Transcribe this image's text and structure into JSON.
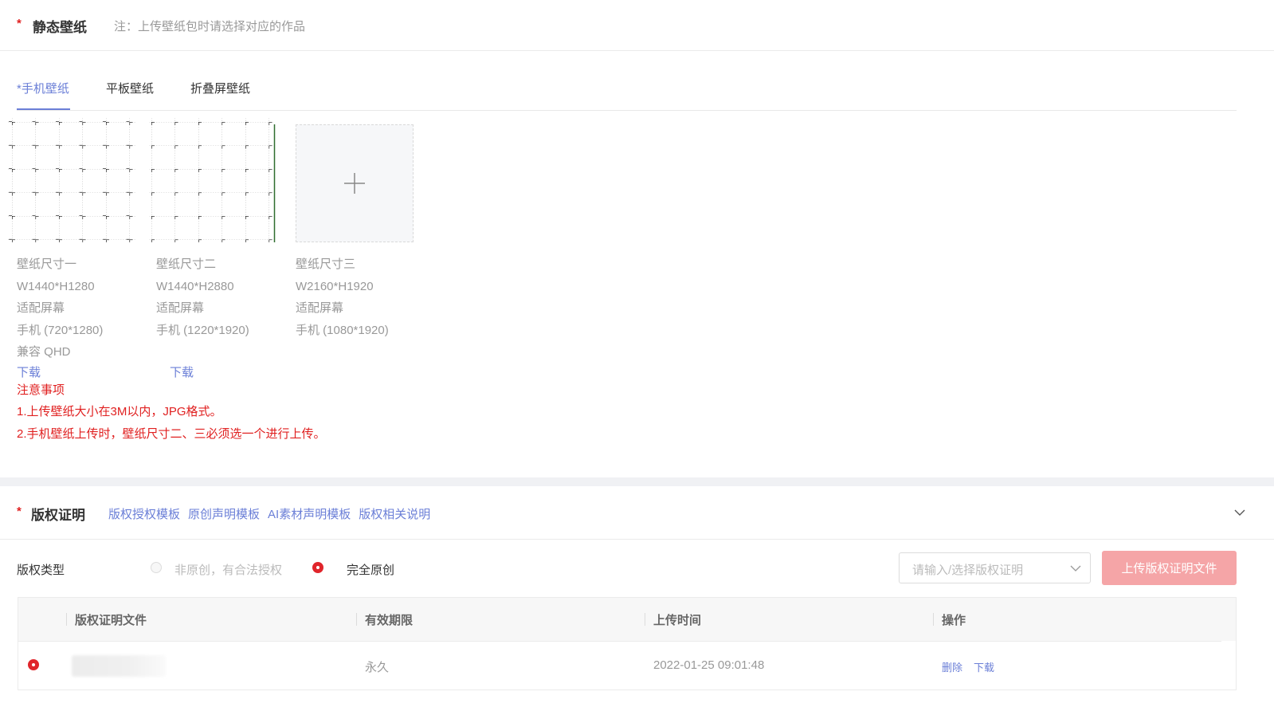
{
  "section1": {
    "star": "*",
    "title": "静态壁纸",
    "hint": "注：上传壁纸包时请选择对应的作品"
  },
  "tabs": [
    {
      "label": "*手机壁纸",
      "active": true
    },
    {
      "label": "平板壁纸",
      "active": false
    },
    {
      "label": "折叠屏壁纸",
      "active": false
    }
  ],
  "slots": [
    {
      "name": "壁纸尺寸一",
      "size": "W1440*H1280",
      "fit_label": "适配屏幕",
      "device": "手机 (720*1280)",
      "compat": "兼容 QHD",
      "download": "下载"
    },
    {
      "name": "壁纸尺寸二",
      "size": "W1440*H2880",
      "fit_label": "适配屏幕",
      "device": "手机 (1220*1920)",
      "download": "下载"
    },
    {
      "name": "壁纸尺寸三",
      "size": "W2160*H1920",
      "fit_label": "适配屏幕",
      "device": "手机 (1080*1920)"
    }
  ],
  "upload_icon": "plus-icon",
  "notice": {
    "title": "注意事项",
    "line1": "1.上传壁纸大小在3M以内，JPG格式。",
    "line2": "2.手机壁纸上传时，壁纸尺寸二、三必须选一个进行上传。"
  },
  "section2": {
    "star": "*",
    "title": "版权证明",
    "links": [
      "版权授权模板",
      "原创声明模板",
      "AI素材声明模板",
      "版权相关说明"
    ],
    "collapse_icon": "chevron-down-icon"
  },
  "copyright_type": {
    "label": "版权类型",
    "options": [
      {
        "label": "非原创，有合法授权",
        "selected": false
      },
      {
        "label": "完全原创",
        "selected": true
      }
    ]
  },
  "select": {
    "placeholder": "请输入/选择版权证明"
  },
  "upload_button": "上传版权证明文件",
  "table": {
    "headers": [
      "版权证明文件",
      "有效期限",
      "上传时间",
      "操作"
    ],
    "rows": [
      {
        "validity": "永久",
        "upload_time": "2022-01-25 09:01:48",
        "actions": [
          "删除",
          "下载"
        ]
      }
    ]
  },
  "colors": {
    "accent": "#6b7fd7",
    "danger": "#e02020",
    "button_disabled": "#f5a5a7"
  }
}
